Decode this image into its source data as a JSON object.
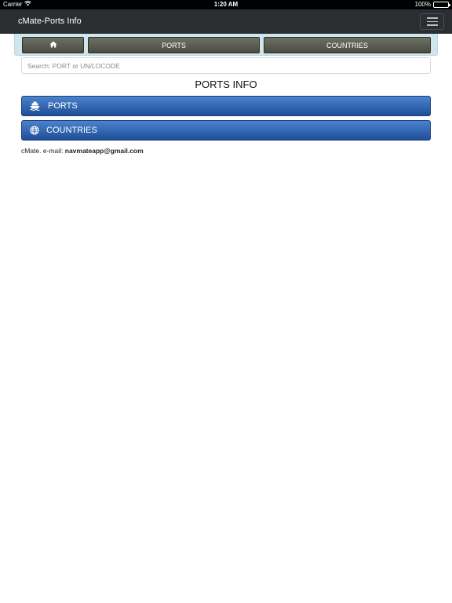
{
  "status_bar": {
    "carrier": "Carrier",
    "wifi_icon": "wifi-icon",
    "time": "1:20 AM",
    "battery": "100%"
  },
  "navbar": {
    "title": "cMate-Ports Info",
    "menu_icon": "hamburger-menu-icon",
    "background": "#2b2e31"
  },
  "tabs": {
    "home_icon": "home-icon",
    "ports_label": "PORTS",
    "countries_label": "COUNTRIES"
  },
  "search": {
    "placeholder": "Search: PORT or UN/LOCODE",
    "value": ""
  },
  "page_title": "PORTS INFO",
  "list": {
    "ports": {
      "label": "PORTS",
      "icon": "ship-icon"
    },
    "countries": {
      "label": "COUNTRIES",
      "icon": "globe-icon"
    },
    "button_color": "#2f63b0"
  },
  "footer": {
    "prefix": "cMate. e-mail: ",
    "email": "navmateapp@gmail.com"
  }
}
